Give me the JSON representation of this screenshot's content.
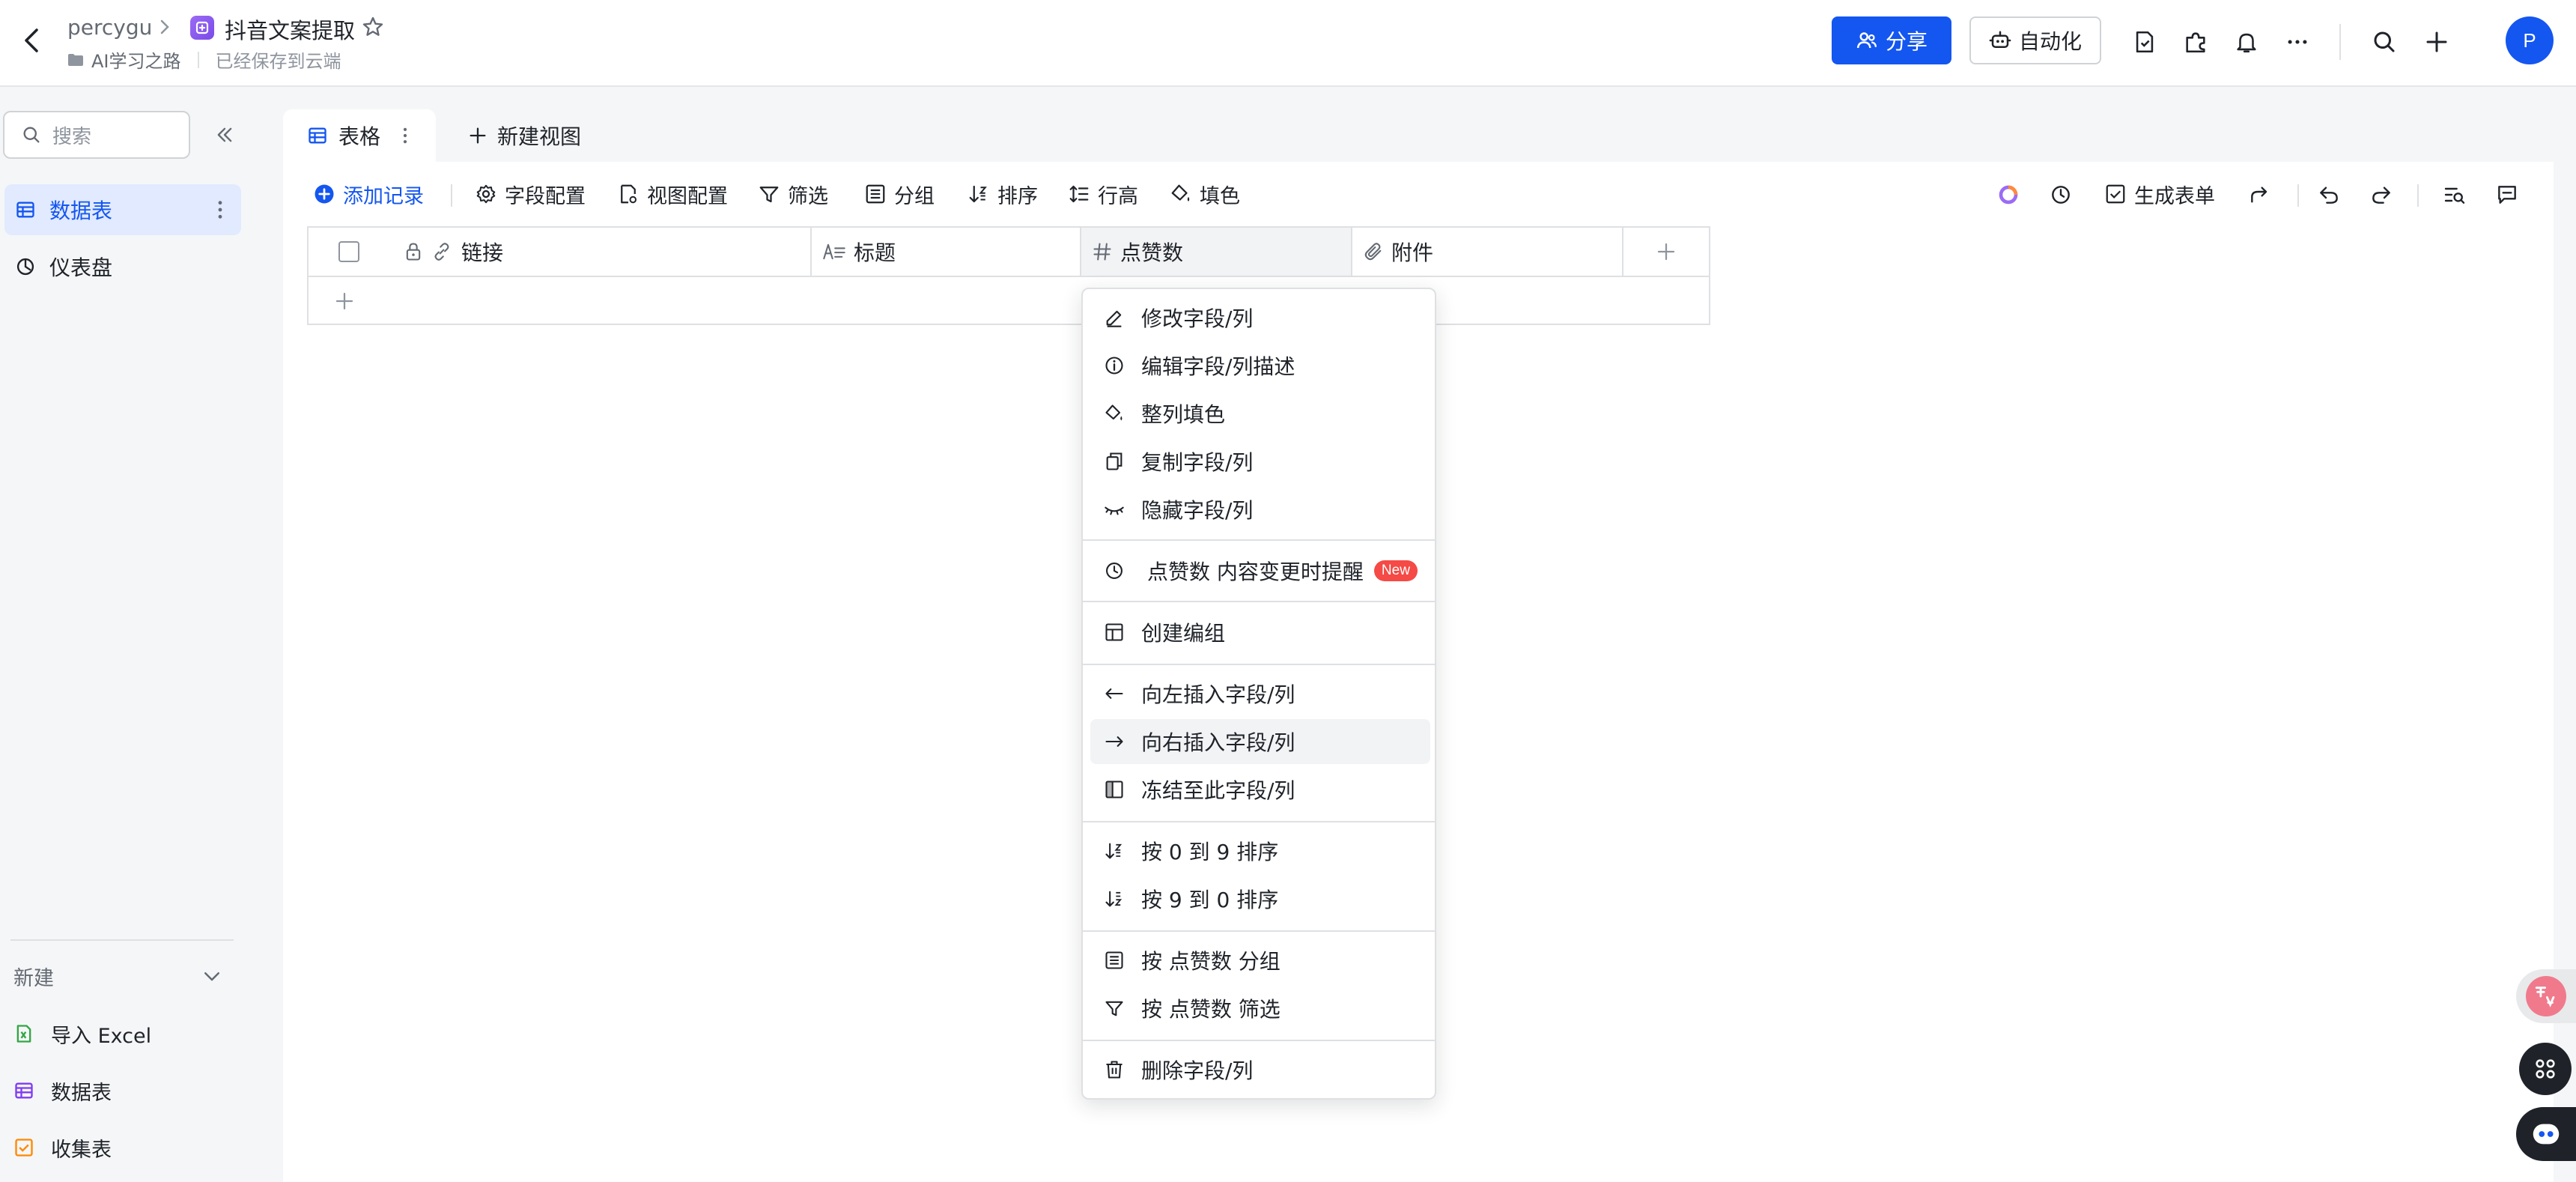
{
  "topbar": {
    "user": "percygu",
    "doc_title": "抖音文案提取",
    "folder": "AI学习之路",
    "save_status": "已经保存到云端",
    "share_label": "分享",
    "automation_label": "自动化",
    "avatar_initial": "P",
    "brand_color": "#1456f0"
  },
  "sidebar": {
    "search_placeholder": "搜索",
    "items": [
      {
        "label": "数据表",
        "icon": "table-icon",
        "active": true
      },
      {
        "label": "仪表盘",
        "icon": "dashboard-icon",
        "active": false
      }
    ],
    "new_label": "新建",
    "new_items": [
      {
        "label": "导入 Excel",
        "icon": "excel-icon"
      },
      {
        "label": "数据表",
        "icon": "table-icon"
      },
      {
        "label": "收集表",
        "icon": "form-icon"
      }
    ]
  },
  "tabs": {
    "active_label": "表格",
    "new_view_label": "新建视图"
  },
  "toolbar": {
    "add_record": "添加记录",
    "field_config": "字段配置",
    "view_config": "视图配置",
    "filter": "筛选",
    "group": "分组",
    "sort": "排序",
    "row_height": "行高",
    "fill_color": "填色",
    "generate_form": "生成表单"
  },
  "grid": {
    "columns": [
      {
        "label": "链接",
        "icon": "link-icon"
      },
      {
        "label": "标题",
        "icon": "text-icon"
      },
      {
        "label": "点赞数",
        "icon": "number-icon"
      },
      {
        "label": "附件",
        "icon": "attachment-icon"
      }
    ]
  },
  "context_menu": {
    "items": [
      {
        "label": "修改字段/列",
        "icon": "edit-icon"
      },
      {
        "label": "编辑字段/列描述",
        "icon": "info-icon"
      },
      {
        "label": "整列填色",
        "icon": "paint-bucket-icon"
      },
      {
        "label": "复制字段/列",
        "icon": "copy-icon"
      },
      {
        "label": "隐藏字段/列",
        "icon": "eye-off-icon"
      },
      {
        "label": "点赞数 内容变更时提醒",
        "icon": "alarm-icon",
        "badge": "New"
      },
      {
        "label": "创建编组",
        "icon": "group-layout-icon"
      },
      {
        "label": "向左插入字段/列",
        "icon": "arrow-left-icon"
      },
      {
        "label": "向右插入字段/列",
        "icon": "arrow-right-icon",
        "hover": true
      },
      {
        "label": "冻结至此字段/列",
        "icon": "freeze-icon"
      },
      {
        "label": "按 0 到 9 排序",
        "icon": "sort-asc-icon"
      },
      {
        "label": "按 9 到 0 排序",
        "icon": "sort-desc-icon"
      },
      {
        "label": "按 点赞数 分组",
        "icon": "group-list-icon"
      },
      {
        "label": "按 点赞数 筛选",
        "icon": "filter-icon"
      },
      {
        "label": "删除字段/列",
        "icon": "trash-icon"
      }
    ]
  }
}
